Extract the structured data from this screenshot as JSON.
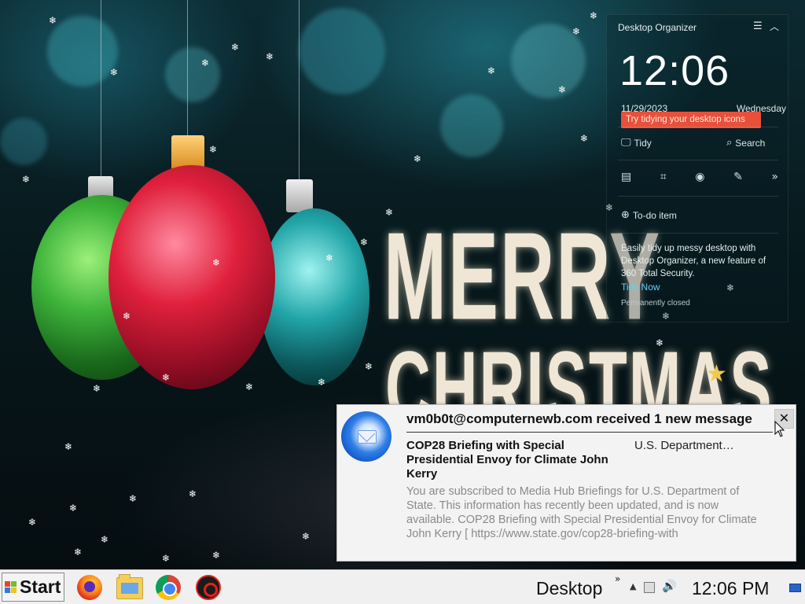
{
  "wallpaper": {
    "line1": "MERRY",
    "line2": "CHRISTMAS"
  },
  "organizer": {
    "header": "Desktop Organizer",
    "menu_icon": "menu-icon",
    "collapse_icon": "chevron-up-icon",
    "clock": "12:06",
    "date": "11/29/2023",
    "day": "Wednesday",
    "tooltip": "Try tidying your desktop icons",
    "tidy_label": "Tidy",
    "search_label": "Search",
    "tool_icons": [
      "notes-icon",
      "crop-icon",
      "eye-icon",
      "memo-icon",
      "forward-icon"
    ],
    "todo_label": "To-do item",
    "description": "Easily tidy up messy desktop with Desktop Organizer, a new feature of 360 Total Security.",
    "tidy_now": "Tidy Now",
    "permanently_closed": "Permanently closed"
  },
  "notification": {
    "title": "vm0b0t@computernewb.com received 1 new message",
    "close_glyph": "✕",
    "subject": "COP28 Briefing with Special Presidential Envoy for Climate John Kerry",
    "sender": "U.S. Department…",
    "body": "You are subscribed to Media Hub Briefings for U.S. Department of State. This information has recently been updated, and is now available. COP28 Briefing with Special Presidential Envoy for Climate John Kerry [ https://www.state.gov/cop28-briefing-with"
  },
  "taskbar": {
    "start_label": "Start",
    "apps": [
      "firefox-icon",
      "file-explorer-icon",
      "chrome-icon",
      "security-app-icon"
    ],
    "desktop_label": "Desktop",
    "overflow_glyph": "»",
    "tray_up_glyph": "▲",
    "volume_glyph": "🔊",
    "clock": "12:06 PM"
  },
  "colors": {
    "tooltip_bg": "#e8503a",
    "link": "#5fd0ff",
    "taskbar_bg": "#f0f0f0",
    "notification_bg": "#f3f3f3"
  }
}
